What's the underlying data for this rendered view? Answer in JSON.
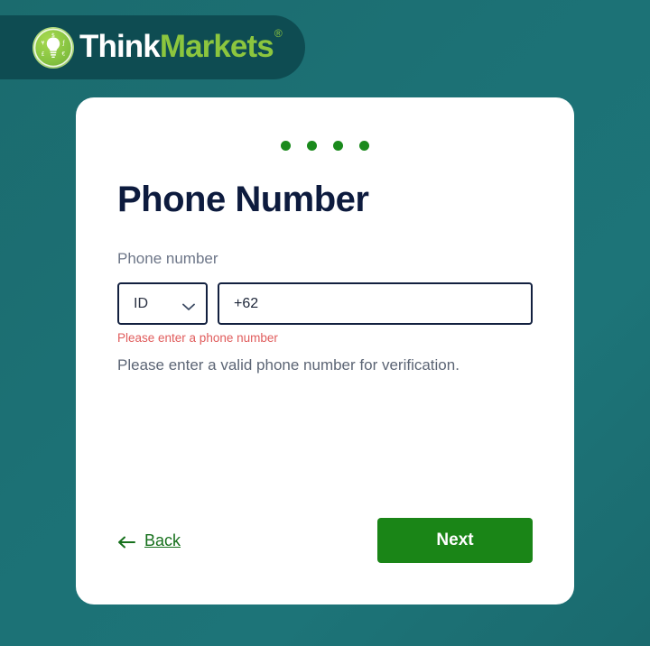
{
  "brand": {
    "name_part1": "Think",
    "name_part2": "Markets",
    "registered_mark": "®",
    "logo_icon": "lightbulb-currency-icon",
    "bar_color": "#0e4c52",
    "accent_green": "#8cc63e"
  },
  "page": {
    "background_color": "#1c7175",
    "title": "Phone Number",
    "progress": {
      "dot_count": 4,
      "dot_color": "#1a8a1c"
    }
  },
  "form": {
    "label": "Phone number",
    "country_select": {
      "selected": "ID",
      "icon": "chevron-down-icon"
    },
    "phone_input": {
      "value": "+62",
      "placeholder": "+62"
    },
    "error_message": "Please enter a phone number",
    "error_color": "#e05c5c",
    "helper_message": "Please enter a valid phone number for verification."
  },
  "footer": {
    "back": {
      "label": "Back",
      "icon": "arrow-left-icon",
      "color": "#16701c"
    },
    "next": {
      "label": "Next",
      "color": "#1a8517"
    }
  }
}
